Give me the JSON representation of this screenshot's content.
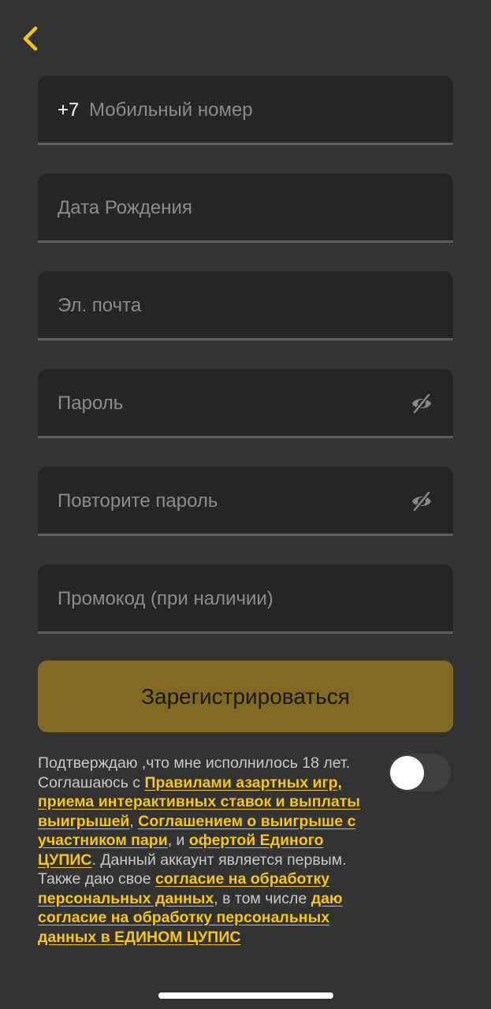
{
  "form": {
    "phone_prefix": "+7",
    "phone_placeholder": "Мобильный номер",
    "birthdate_placeholder": "Дата Рождения",
    "email_placeholder": "Эл. почта",
    "password_placeholder": "Пароль",
    "repeat_password_placeholder": "Повторите пароль",
    "promo_placeholder": "Промокод (при наличии)"
  },
  "register_button_label": "Зарегистрироваться",
  "consent": {
    "text1": "Подтверждаю ,что мне исполнилось 18 лет. Соглашаюсь с ",
    "link1": "Правилами азартных игр, приема интерактивных ставок и выплаты выигрышей",
    "text2": ", ",
    "link2": "Соглашением о выигрыше с участником пари",
    "text3": ", и ",
    "link3": "офертой Единого ЦУПИС",
    "text4": ". Данный аккаунт является первым. Также даю свое ",
    "link4": "согласие на обработку персональных данных",
    "text5": ", в том числе ",
    "link5": "даю согласие на обработку персональных данных в ЕДИНОМ ЦУПИС",
    "toggle_on": false
  },
  "icons": {
    "back": "chevron-left-icon",
    "password_visibility": "eye-off-icon"
  },
  "colors": {
    "background": "#333333",
    "field_background": "#262626",
    "accent": "#f5c518",
    "button_background": "#836a22"
  }
}
